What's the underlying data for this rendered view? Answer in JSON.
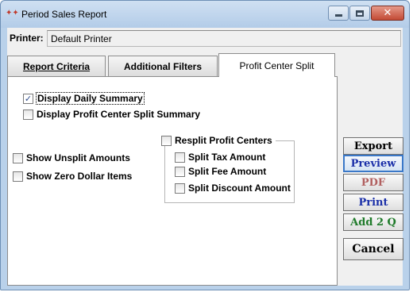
{
  "window": {
    "title": "Period Sales Report",
    "icon": "sales-report-app-icon",
    "controls": {
      "minimize": "minimize-icon",
      "maximize": "maximize-icon",
      "close": "close-icon"
    }
  },
  "printer": {
    "label": "Printer:",
    "value": "Default Printer"
  },
  "tabs": [
    {
      "label": "Report Criteria",
      "active": false
    },
    {
      "label": "Additional Filters",
      "active": false
    },
    {
      "label": "Profit Center Split",
      "active": true
    }
  ],
  "options": {
    "display_daily_summary": {
      "label": "Display Daily Summary",
      "checked": true
    },
    "display_profit_center_split_summary": {
      "label": "Display Profit Center Split Summary",
      "checked": false
    },
    "show_unsplit_amounts": {
      "label": "Show Unsplit Amounts",
      "checked": false
    },
    "show_zero_dollar_items": {
      "label": "Show Zero Dollar Items",
      "checked": false
    },
    "resplit_profit_centers": {
      "label": "Resplit Profit Centers",
      "checked": false
    },
    "split_tax_amount": {
      "label": "Split Tax Amount",
      "checked": false
    },
    "split_fee_amount": {
      "label": "Split Fee Amount",
      "checked": false
    },
    "split_discount_amount": {
      "label": "Split Discount Amount",
      "checked": false
    }
  },
  "actions": {
    "export": "Export",
    "preview": "Preview",
    "pdf": "PDF",
    "print": "Print",
    "add_2_q": "Add 2 Q",
    "cancel": "Cancel"
  },
  "colors": {
    "preview": "#1a2fa8",
    "pdf": "#b16060",
    "print": "#1a2fa8",
    "add_2_q": "#1f7a2a",
    "checkmark": "#2c4a8a"
  }
}
